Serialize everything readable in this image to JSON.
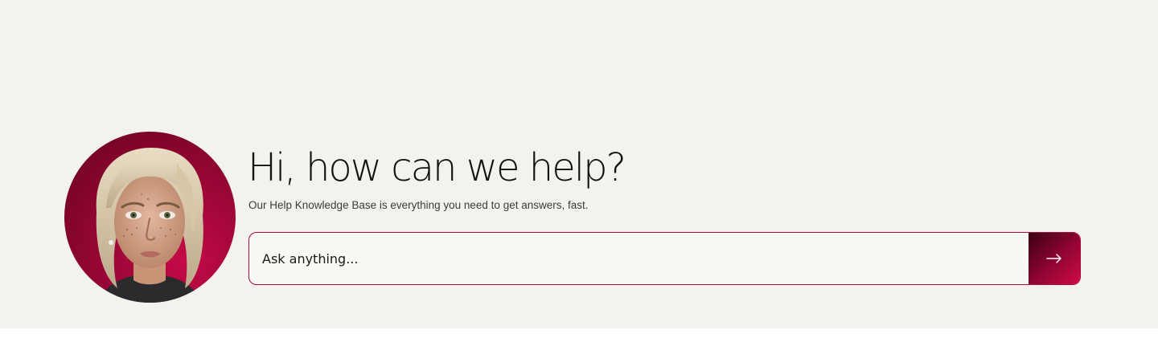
{
  "hero": {
    "title": "Hi, how can we help?",
    "subtitle": "Our Help Knowledge Base is everything you need to get answers, fast."
  },
  "search": {
    "placeholder": "Ask anything..."
  },
  "icons": {
    "submit": "arrow-right-icon",
    "avatar": "support-agent-avatar"
  },
  "colors": {
    "background": "#f3f3ee",
    "accent": "#b0063e",
    "button_gradient_start": "#3a0014",
    "button_gradient_end": "#d10a48",
    "title": "#111111"
  }
}
